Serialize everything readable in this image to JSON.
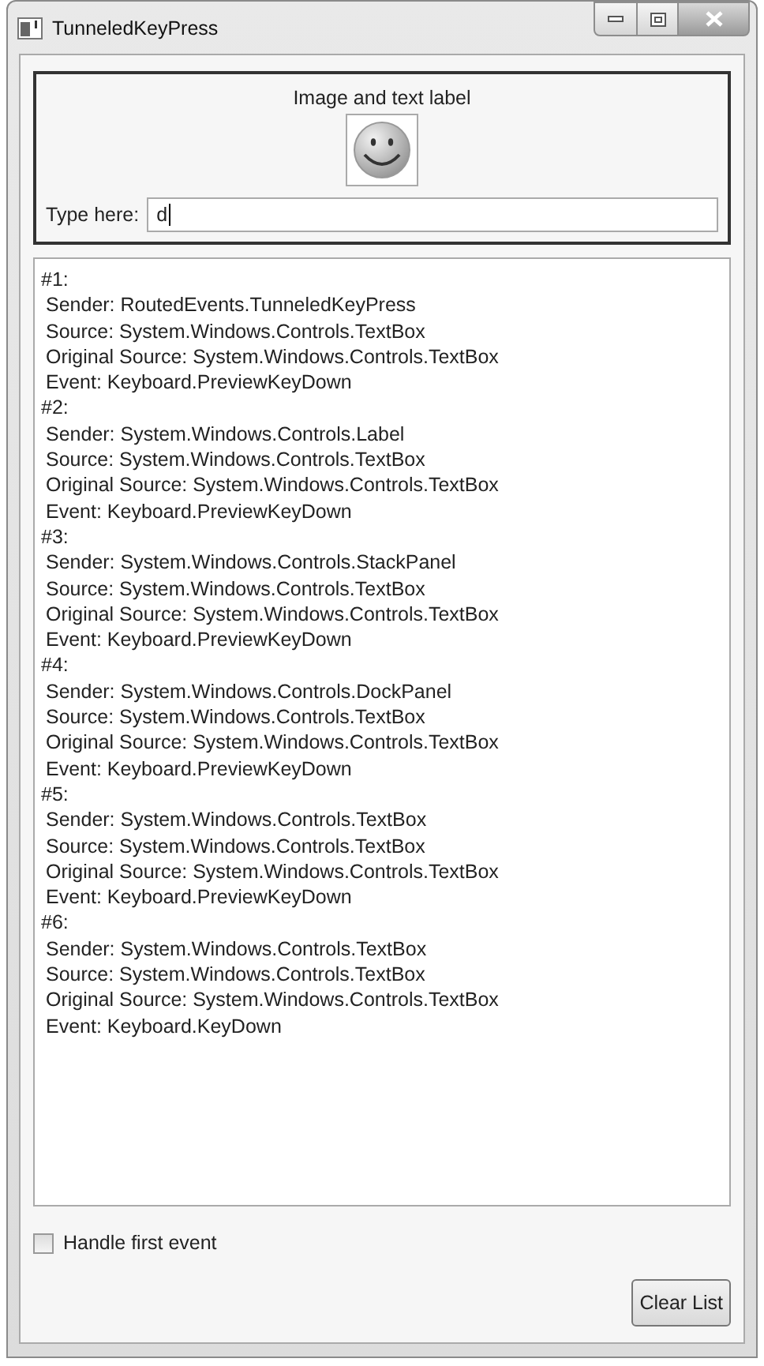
{
  "window": {
    "title": "TunneledKeyPress"
  },
  "label_area": {
    "caption": "Image and text label",
    "input_label": "Type here:",
    "input_value": "d"
  },
  "event_list": [
    {
      "header": "#1:",
      "lines": [
        "Sender: RoutedEvents.TunneledKeyPress",
        "Source: System.Windows.Controls.TextBox",
        "Original Source: System.Windows.Controls.TextBox",
        "Event: Keyboard.PreviewKeyDown"
      ]
    },
    {
      "header": "#2:",
      "lines": [
        "Sender: System.Windows.Controls.Label",
        "Source: System.Windows.Controls.TextBox",
        "Original Source: System.Windows.Controls.TextBox",
        "Event: Keyboard.PreviewKeyDown"
      ]
    },
    {
      "header": "#3:",
      "lines": [
        "Sender: System.Windows.Controls.StackPanel",
        "Source: System.Windows.Controls.TextBox",
        "Original Source: System.Windows.Controls.TextBox",
        "Event: Keyboard.PreviewKeyDown"
      ]
    },
    {
      "header": "#4:",
      "lines": [
        "Sender: System.Windows.Controls.DockPanel",
        "Source: System.Windows.Controls.TextBox",
        "Original Source: System.Windows.Controls.TextBox",
        "Event: Keyboard.PreviewKeyDown"
      ]
    },
    {
      "header": "#5:",
      "lines": [
        "Sender: System.Windows.Controls.TextBox",
        "Source: System.Windows.Controls.TextBox",
        "Original Source: System.Windows.Controls.TextBox",
        "Event: Keyboard.PreviewKeyDown"
      ]
    },
    {
      "header": "#6:",
      "lines": [
        "Sender: System.Windows.Controls.TextBox",
        "Source: System.Windows.Controls.TextBox",
        "Original Source: System.Windows.Controls.TextBox",
        "Event: Keyboard.KeyDown"
      ]
    }
  ],
  "handle_first_event": {
    "label": "Handle first event",
    "checked": false
  },
  "clear_button": {
    "label": "Clear List"
  }
}
